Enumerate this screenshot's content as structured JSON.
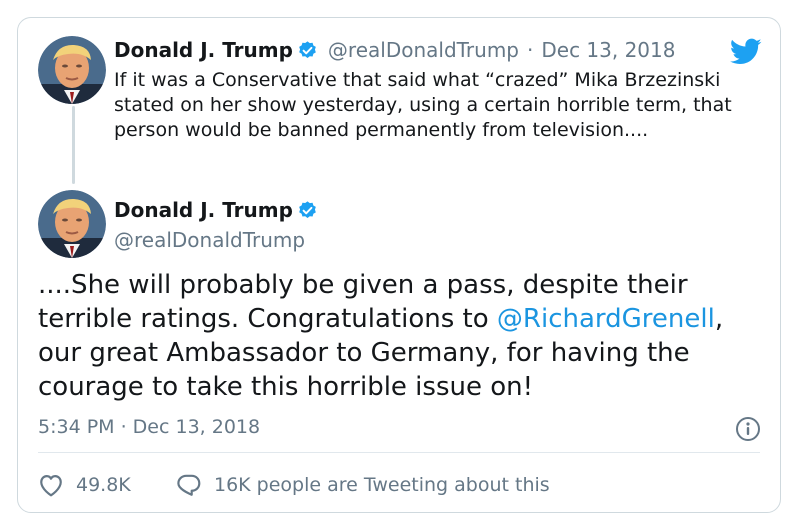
{
  "reply_tweet": {
    "author_name": "Donald J. Trump",
    "handle": "@realDonaldTrump",
    "separator": "·",
    "date": "Dec 13, 2018",
    "text": "If it was a Conservative that said what “crazed” Mika Brzezinski stated on her show yesterday, using a certain horrible term, that person would be banned permanently from television...."
  },
  "main_tweet": {
    "author_name": "Donald J. Trump",
    "handle": "@realDonaldTrump",
    "text_before": "....She will probably be given a pass, despite their terrible ratings. Congratulations to ",
    "mention": "@RichardGrenell",
    "text_after": ", our great Ambassador to Germany, for having the courage to take this horrible issue on!",
    "timestamp": "5:34 PM · Dec 13, 2018"
  },
  "actions": {
    "likes": "49.8K",
    "replies_text": "16K people are Tweeting about this"
  },
  "icons": {
    "brand": "twitter-bird-icon",
    "verified": "verified-badge-icon",
    "info": "info-icon",
    "like": "heart-icon",
    "reply": "speech-bubble-icon"
  },
  "colors": {
    "brand_blue": "#1da1f2",
    "mention_blue": "#1b95e0",
    "secondary_text": "#657786",
    "border": "#cfd9de"
  }
}
